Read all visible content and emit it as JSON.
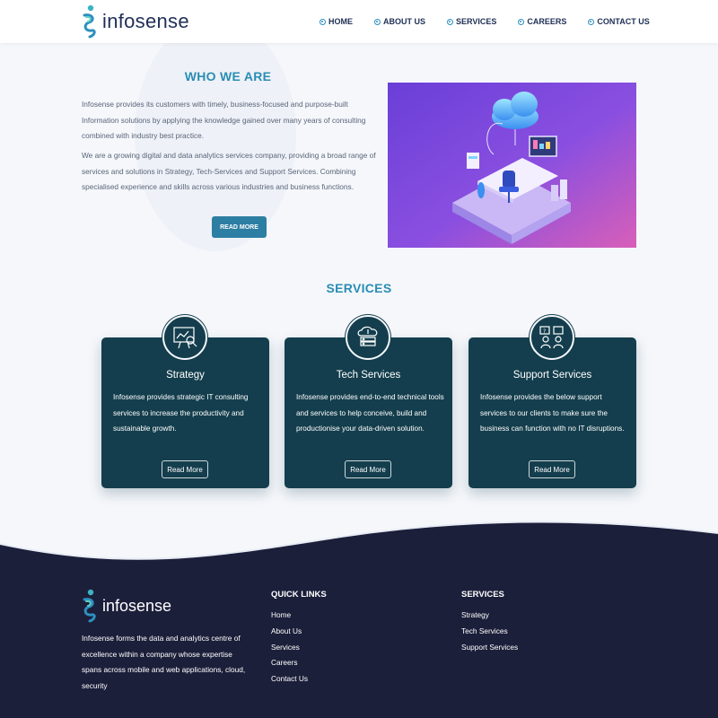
{
  "brand": {
    "name": "infosense"
  },
  "nav": [
    {
      "label": "HOME"
    },
    {
      "label": "ABOUT US"
    },
    {
      "label": "SERVICES"
    },
    {
      "label": "CAREERS"
    },
    {
      "label": "CONTACT US"
    }
  ],
  "who": {
    "title": "WHO WE ARE",
    "p1": "Infosense provides its customers with timely, business-focused and purpose-built Information solutions by applying the knowledge gained over many years of consulting combined with industry best practice.",
    "p2": "We are a growing digital and data analytics services company, providing a broad range of services and solutions in Strategy, Tech-Services and Support Services. Combining specialised experience and skills across various industries and business functions.",
    "button": "READ MORE"
  },
  "services": {
    "title": "SERVICES",
    "cards": [
      {
        "title": "Strategy",
        "desc": "Infosense provides strategic IT consulting services to increase the productivity and sustainable growth.",
        "button": "Read More",
        "icon": "strategy-chart-icon"
      },
      {
        "title": "Tech Services",
        "desc": "Infosense provides end-to-end technical tools and services to help conceive, build and productionise your data-driven solution.",
        "button": "Read More",
        "icon": "cloud-server-icon"
      },
      {
        "title": "Support Services",
        "desc": "Infosense provides the below support services to our clients to make sure the business can function with no IT disruptions.",
        "button": "Read More",
        "icon": "support-team-icon"
      }
    ]
  },
  "footer": {
    "about": "Infosense forms the data and analytics centre of excellence within a company whose expertise spans across mobile and web applications, cloud, security",
    "quick_links_title": "QUICK LINKS",
    "quick_links": [
      "Home",
      "About Us",
      "Services",
      "Careers",
      "Contact Us"
    ],
    "services_title": "SERVICES",
    "services": [
      "Strategy",
      "Tech Services",
      "Support Services"
    ]
  },
  "colors": {
    "accent": "#2a8db4",
    "card": "#143e4d",
    "footer": "#1c1f3a",
    "nav_text": "#1f2f56"
  }
}
